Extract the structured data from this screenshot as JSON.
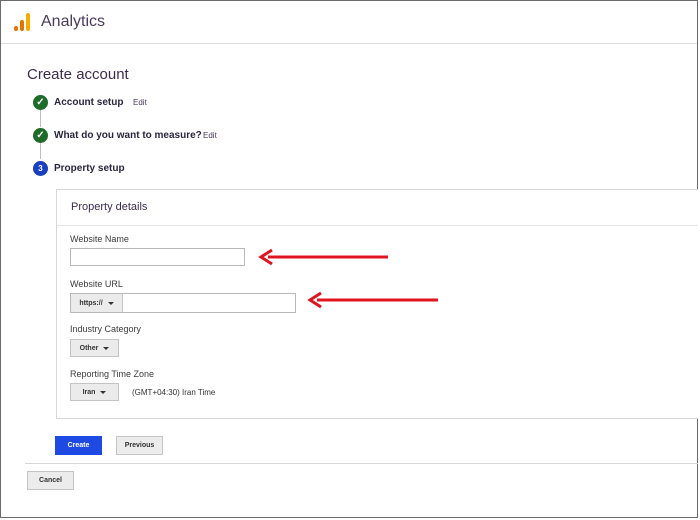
{
  "app": {
    "title": "Analytics",
    "logo_colors": [
      "#f9ab00",
      "#e37400",
      "#e37400"
    ]
  },
  "page": {
    "title": "Create account"
  },
  "steps": [
    {
      "label": "Account setup",
      "status": "done",
      "edit_label": "Edit",
      "icon": "check-icon"
    },
    {
      "label": "What do you want to measure?",
      "status": "done",
      "edit_label": "Edit",
      "icon": "check-icon"
    },
    {
      "label": "Property setup",
      "status": "current",
      "number": "3"
    }
  ],
  "property_details": {
    "title": "Property details",
    "website_name": {
      "label": "Website Name",
      "value": ""
    },
    "website_url": {
      "label": "Website URL",
      "protocol": "https://",
      "value": ""
    },
    "industry_category": {
      "label": "Industry Category",
      "selected": "Other"
    },
    "reporting_time_zone": {
      "label": "Reporting Time Zone",
      "country": "Iran",
      "zone": "(GMT+04:30) Iran Time"
    }
  },
  "actions": {
    "create_label": "Create",
    "previous_label": "Previous",
    "cancel_label": "Cancel"
  },
  "annotations": {
    "arrow_color": "#e0141e"
  },
  "colors": {
    "step_done": "#1e6b2a",
    "step_current": "#1a3fbf",
    "primary_button": "#1f49e3"
  }
}
